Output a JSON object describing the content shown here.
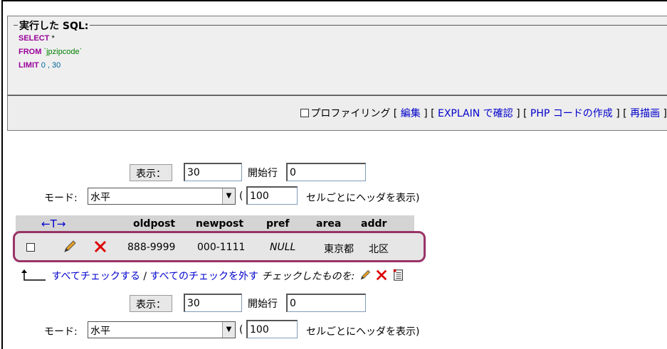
{
  "sql": {
    "legend": "実行した SQL:",
    "lines": [
      {
        "kw": "SELECT",
        "rest": " *"
      },
      {
        "kw": "FROM",
        "rest": " `jpzipcode`"
      },
      {
        "kw": "LIMIT",
        "rest": " 0 , 30"
      }
    ]
  },
  "toolbar": {
    "profiling": "プロファイリング",
    "edit": "編集",
    "explain": "EXPLAIN で確認",
    "php": "PHP コードの作成",
    "refresh": "再描画"
  },
  "nav_top": {
    "show_btn": "表示：",
    "rows_value": "30",
    "start_label": "開始行",
    "start_value": "0",
    "mode_label": "モード:",
    "mode_value": "水平",
    "paren_open": "(",
    "headers_value": "100",
    "headers_label": "セルごとにヘッダを表示)"
  },
  "nav_bottom": {
    "show_btn": "表示：",
    "rows_value": "30",
    "start_label": "開始行",
    "start_value": "0",
    "mode_label": "モード:",
    "mode_value": "水平",
    "paren_open": "(",
    "headers_value": "100",
    "headers_label": "セルごとにヘッダを表示)"
  },
  "table": {
    "arrows": "←T→",
    "columns": [
      "oldpost",
      "newpost",
      "pref",
      "area",
      "addr"
    ],
    "rows": [
      {
        "oldpost": "888-9999",
        "newpost": "000-1111",
        "pref": "NULL",
        "area": "東京都",
        "addr": "北区"
      }
    ]
  },
  "bulk": {
    "check_all": "すべてチェックする",
    "sep": " / ",
    "uncheck_all": "すべてのチェックを外す",
    "with_selected": "チェックしたものを:"
  },
  "colors": {
    "keyword": "#990099",
    "string": "#008000",
    "number": "#006699",
    "link": "#0000cc",
    "highlight": "#993366"
  }
}
